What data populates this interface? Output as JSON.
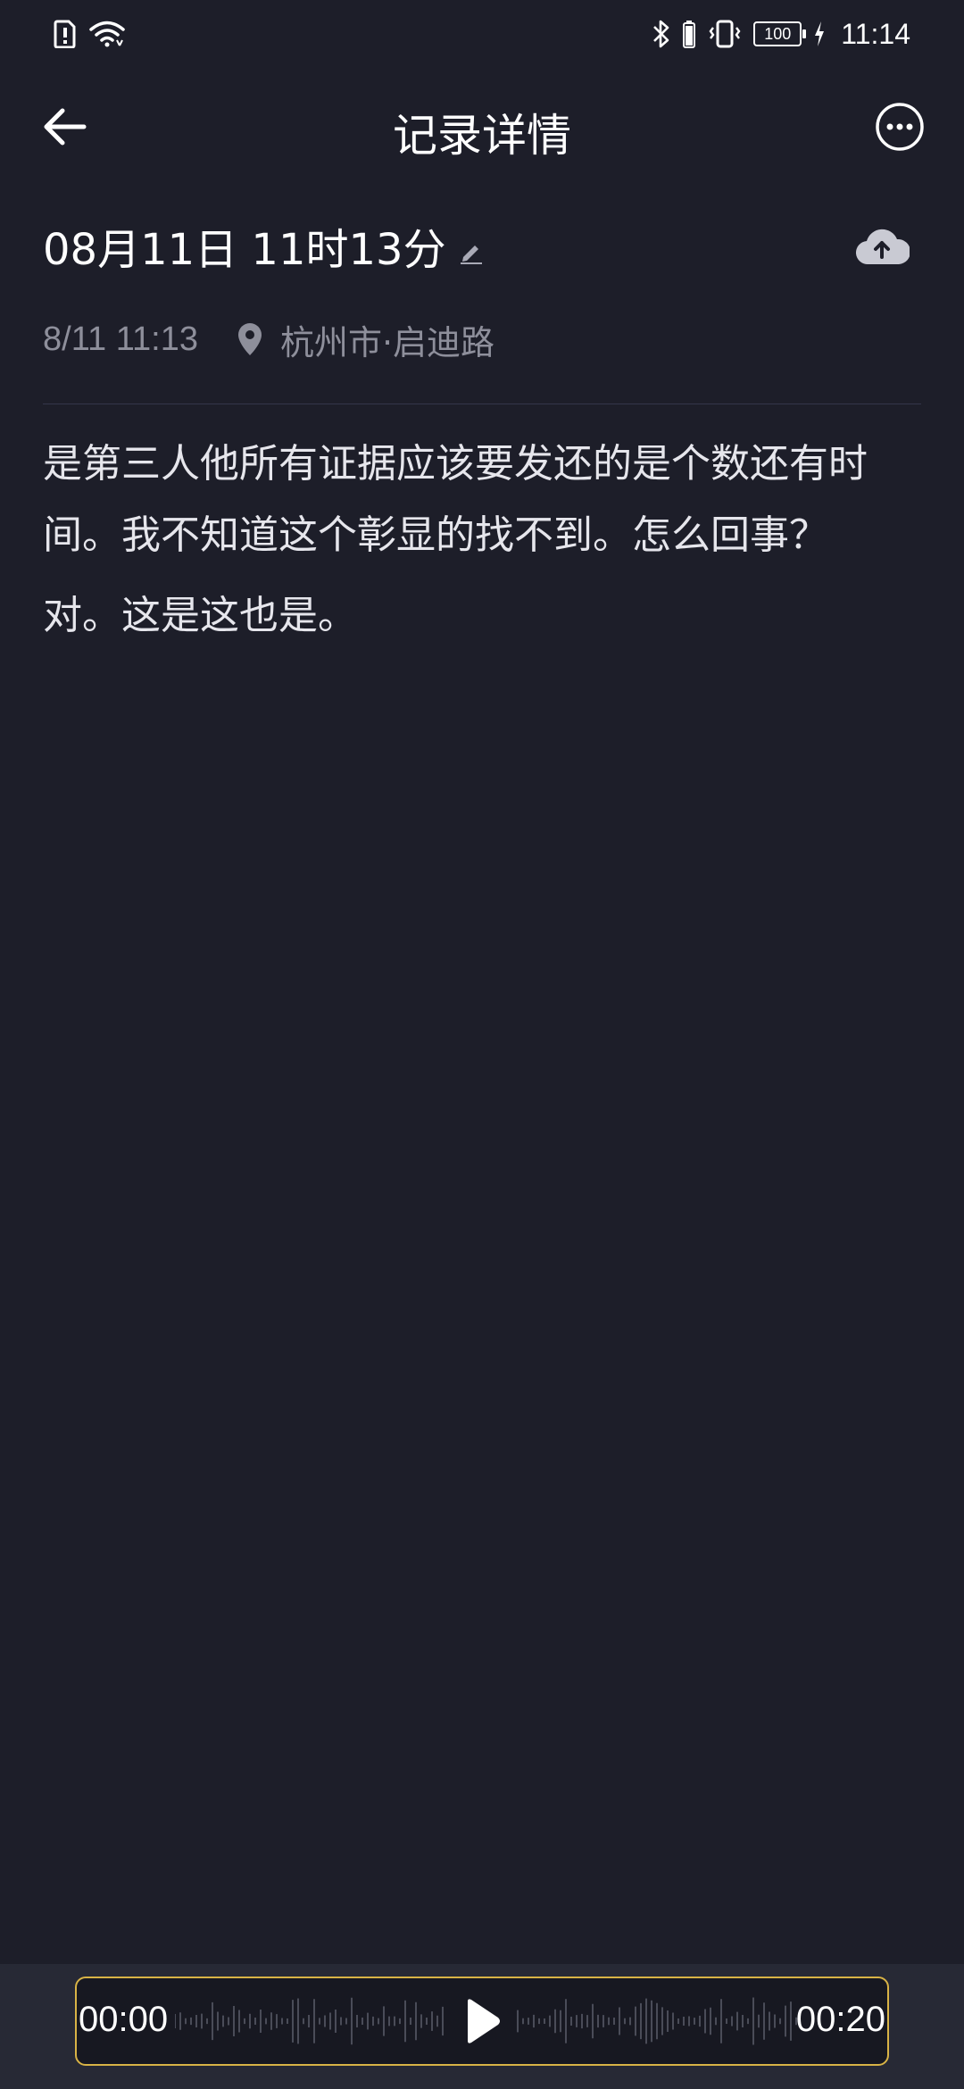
{
  "status_bar": {
    "time": "11:14",
    "battery": "100",
    "icons": [
      "sim-alert-icon",
      "wifi-icon",
      "bluetooth-icon",
      "vibrate-icon",
      "battery-icon",
      "charging-icon"
    ]
  },
  "header": {
    "title": "记录详情",
    "back_icon": "back-arrow-icon",
    "more_icon": "more-options-icon"
  },
  "record": {
    "title": "08月11日 11时13分",
    "time": "8/11 11:13",
    "location": "杭州市·启迪路",
    "paragraphs": [
      "是第三人他所有证据应该要发还的是个数还有时间。我不知道这个彰显的找不到。怎么回事？",
      "对。这是这也是。"
    ]
  },
  "player": {
    "current_time": "00:00",
    "total_time": "00:20",
    "state": "paused",
    "accent_color": "#d8b346"
  },
  "colors": {
    "background": "#1d1e29",
    "secondary_text": "#8e8f9b",
    "player_background": "#272935"
  }
}
